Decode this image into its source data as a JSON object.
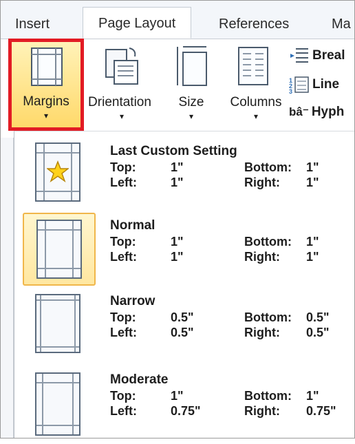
{
  "tabs": [
    {
      "label": "Insert"
    },
    {
      "label": "Page Layout"
    },
    {
      "label": "References"
    },
    {
      "label": "Ma"
    }
  ],
  "ribbon": {
    "margins_label": "Margins",
    "orientation_label": "Drientation",
    "size_label": "Size",
    "columns_label": "Columns",
    "breaks_label": "Breal",
    "line_numbers_label": "Line",
    "hyphenation_label": "Hyph",
    "hyphenation_glyph": "bâ⁻"
  },
  "caret_glyph": "▾",
  "margins_menu": [
    {
      "name": "Last Custom Setting",
      "top_label": "Top:",
      "top": "1\"",
      "bottom_label": "Bottom:",
      "bottom": "1\"",
      "left_label": "Left:",
      "left": "1\"",
      "right_label": "Right:",
      "right": "1\"",
      "icon": "star-icon"
    },
    {
      "name": "Normal",
      "top_label": "Top:",
      "top": "1\"",
      "bottom_label": "Bottom:",
      "bottom": "1\"",
      "left_label": "Left:",
      "left": "1\"",
      "right_label": "Right:",
      "right": "1\"",
      "selected": true
    },
    {
      "name": "Narrow",
      "top_label": "Top:",
      "top": "0.5\"",
      "bottom_label": "Bottom:",
      "bottom": "0.5\"",
      "left_label": "Left:",
      "left": "0.5\"",
      "right_label": "Right:",
      "right": "0.5\""
    },
    {
      "name": "Moderate",
      "top_label": "Top:",
      "top": "1\"",
      "bottom_label": "Bottom:",
      "bottom": "1\"",
      "left_label": "Left:",
      "left": "0.75\"",
      "right_label": "Right:",
      "right": "0.75\""
    }
  ],
  "colors": {
    "highlight": "#e21b24",
    "selected_fill": "#ffe7a0",
    "selected_border": "#f0b64a",
    "star": "#ffd21a"
  }
}
